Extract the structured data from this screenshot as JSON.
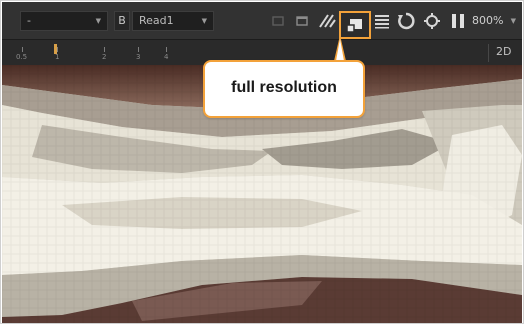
{
  "toolbar": {
    "input_dropdown_value": "-",
    "b_button_label": "B",
    "node_dropdown_value": "Read1",
    "zoom_value": "800%",
    "icons": [
      "frame-outline-icon",
      "roi-icon",
      "striped-icon",
      "full-resolution-icon",
      "lines-icon",
      "refresh-icon",
      "settings-icon",
      "pause-icon"
    ]
  },
  "ruler": {
    "tick_labels": [
      "0.5",
      "1",
      "2",
      "3",
      "4"
    ],
    "view_mode": "2D"
  },
  "tooltip": {
    "text": "full resolution"
  },
  "colors": {
    "accent": "#f3a23a",
    "toolbar_bg": "#323232"
  }
}
